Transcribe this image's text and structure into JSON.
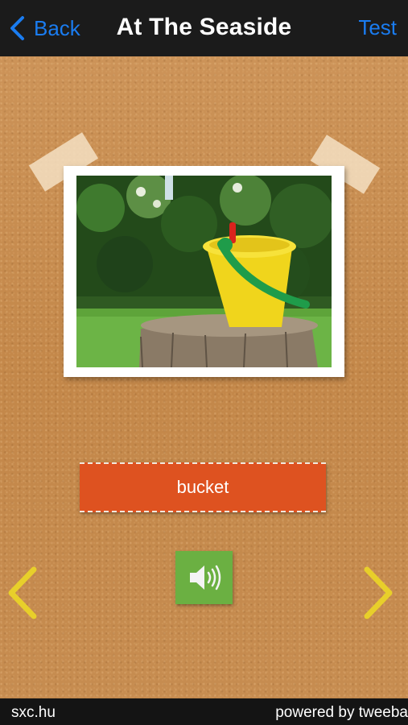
{
  "navbar": {
    "back_label": "Back",
    "title": "At The Seaside",
    "test_label": "Test",
    "accent_color": "#1a7cf0"
  },
  "card": {
    "image_icon": "bucket-photo",
    "word": "bucket",
    "word_strip_color": "#de5220",
    "sound_icon": "speaker-icon",
    "sound_button_color": "#6bb042"
  },
  "navigation": {
    "prev_icon": "chevron-left-icon",
    "next_icon": "chevron-right-icon",
    "arrow_color": "#e8cf2a"
  },
  "footer": {
    "left_text": "sxc.hu",
    "right_text": "powered by tweeba"
  }
}
